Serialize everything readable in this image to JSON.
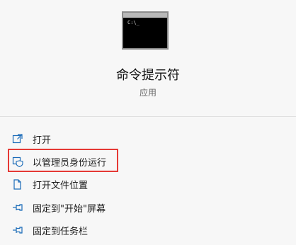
{
  "app": {
    "title": "命令提示符",
    "subtitle": "应用",
    "icon": "command-prompt-icon"
  },
  "menu": {
    "items": [
      {
        "label": "打开",
        "icon": "open-icon"
      },
      {
        "label": "以管理员身份运行",
        "icon": "run-as-admin-icon"
      },
      {
        "label": "打开文件位置",
        "icon": "file-location-icon"
      },
      {
        "label": "固定到\"开始\"屏幕",
        "icon": "pin-icon"
      },
      {
        "label": "固定到任务栏",
        "icon": "pin-icon"
      }
    ]
  },
  "colors": {
    "accent": "#1a6bb8",
    "highlight": "#e53935",
    "background": "#f7f7f7"
  }
}
